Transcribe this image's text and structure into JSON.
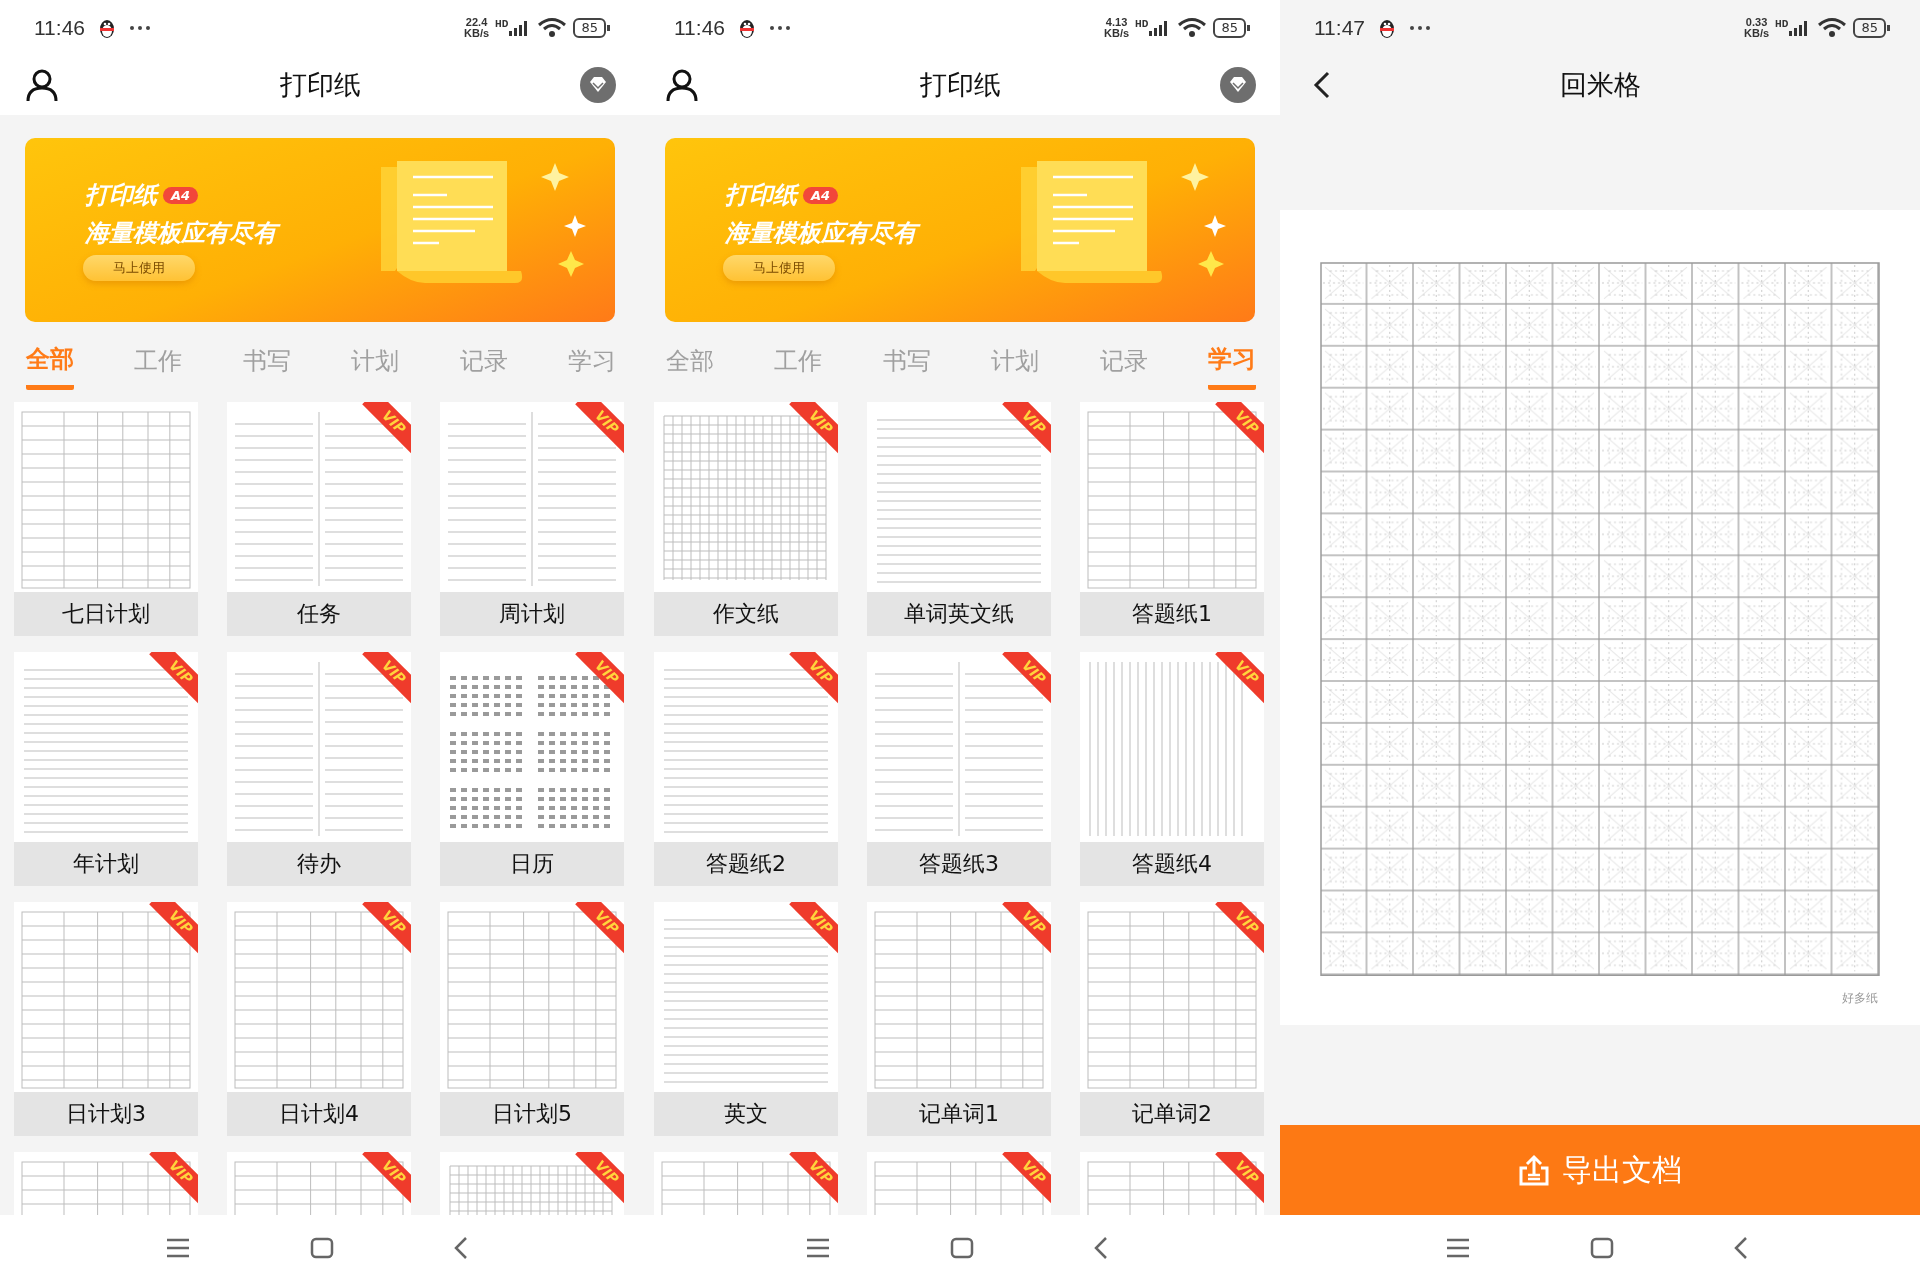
{
  "screens": [
    {
      "kind": "catalog",
      "status_bar": {
        "time": "11:46",
        "speed": "22.4",
        "speed_unit": "KB/s",
        "network": "HD",
        "battery": "85"
      },
      "header": {
        "title": "打印纸"
      },
      "banner": {
        "title": "打印纸",
        "badge": "A4",
        "subtitle": "海量模板应有尽有",
        "button": "马上使用"
      },
      "tabs": [
        {
          "label": "全部",
          "selected": true
        },
        {
          "label": "工作",
          "selected": false
        },
        {
          "label": "书写",
          "selected": false
        },
        {
          "label": "计划",
          "selected": false
        },
        {
          "label": "记录",
          "selected": false
        },
        {
          "label": "学习",
          "selected": false
        }
      ],
      "templates": [
        {
          "label": "七日计划",
          "kind": "table"
        },
        {
          "label": "任务",
          "kind": "columns",
          "badge": "VIP"
        },
        {
          "label": "周计划",
          "kind": "columns",
          "badge": "VIP"
        },
        {
          "label": "年计划",
          "kind": "lines",
          "badge": "VIP"
        },
        {
          "label": "待办",
          "kind": "columns",
          "badge": "VIP"
        },
        {
          "label": "日历",
          "kind": "calendar",
          "badge": "VIP"
        },
        {
          "label": "日计划3",
          "kind": "table",
          "badge": "VIP"
        },
        {
          "label": "日计划4",
          "kind": "table",
          "badge": "VIP"
        },
        {
          "label": "日计划5",
          "kind": "table",
          "badge": "VIP"
        },
        {
          "kind": "table",
          "badge": "VIP"
        },
        {
          "kind": "table",
          "badge": "VIP"
        },
        {
          "kind": "grid",
          "badge": "VIP"
        }
      ]
    },
    {
      "kind": "catalog",
      "status_bar": {
        "time": "11:46",
        "speed": "4.13",
        "speed_unit": "KB/s",
        "network": "HD",
        "battery": "85"
      },
      "header": {
        "title": "打印纸"
      },
      "banner": {
        "title": "打印纸",
        "badge": "A4",
        "subtitle": "海量模板应有尽有",
        "button": "马上使用"
      },
      "tabs": [
        {
          "label": "全部",
          "selected": false
        },
        {
          "label": "工作",
          "selected": false
        },
        {
          "label": "书写",
          "selected": false
        },
        {
          "label": "计划",
          "selected": false
        },
        {
          "label": "记录",
          "selected": false
        },
        {
          "label": "学习",
          "selected": true
        }
      ],
      "templates": [
        {
          "label": "作文纸",
          "kind": "grid",
          "badge": "VIP"
        },
        {
          "label": "单词英文纸",
          "kind": "lines",
          "badge": "VIP"
        },
        {
          "label": "答题纸1",
          "kind": "table",
          "badge": "VIP"
        },
        {
          "label": "答题纸2",
          "kind": "lines",
          "badge": "VIP"
        },
        {
          "label": "答题纸3",
          "kind": "columns",
          "badge": "VIP"
        },
        {
          "label": "答题纸4",
          "kind": "vlines",
          "badge": "VIP"
        },
        {
          "label": "英文",
          "kind": "lines",
          "badge": "VIP"
        },
        {
          "label": "记单词1",
          "kind": "table",
          "badge": "VIP"
        },
        {
          "label": "记单词2",
          "kind": "table",
          "badge": "VIP"
        },
        {
          "kind": "table",
          "badge": "VIP"
        },
        {
          "kind": "table",
          "badge": "VIP"
        },
        {
          "kind": "table",
          "badge": "VIP"
        }
      ]
    },
    {
      "kind": "detail",
      "status_bar": {
        "time": "11:47",
        "speed": "0.33",
        "speed_unit": "KB/s",
        "network": "HD",
        "battery": "85"
      },
      "header": {
        "title": "回米格"
      },
      "paper": {
        "watermark": "好多纸"
      },
      "export_button": "导出文档"
    }
  ]
}
